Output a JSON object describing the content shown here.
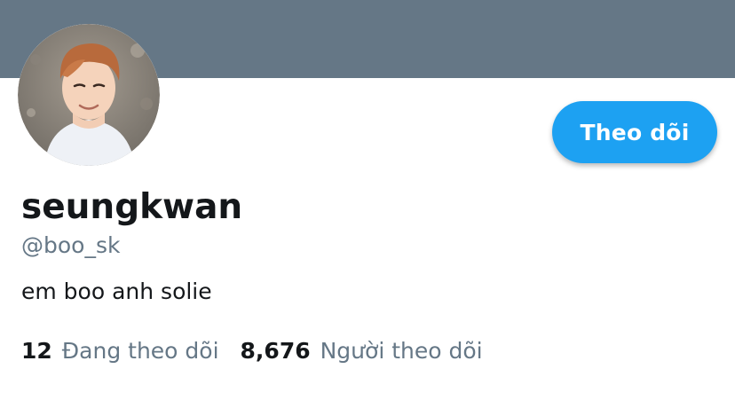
{
  "colors": {
    "banner": "#657786",
    "accent": "#1da1f2",
    "text_primary": "#14171a",
    "text_secondary": "#657786"
  },
  "profile": {
    "avatar_icon": "profile-photo",
    "display_name": "seungkwan",
    "handle": "@boo_sk",
    "bio": "em boo anh solie"
  },
  "actions": {
    "follow_label": "Theo dõi"
  },
  "stats": {
    "following_count": "12",
    "following_label": "Đang theo dõi",
    "followers_count": "8,676",
    "followers_label": "Người theo dõi"
  }
}
